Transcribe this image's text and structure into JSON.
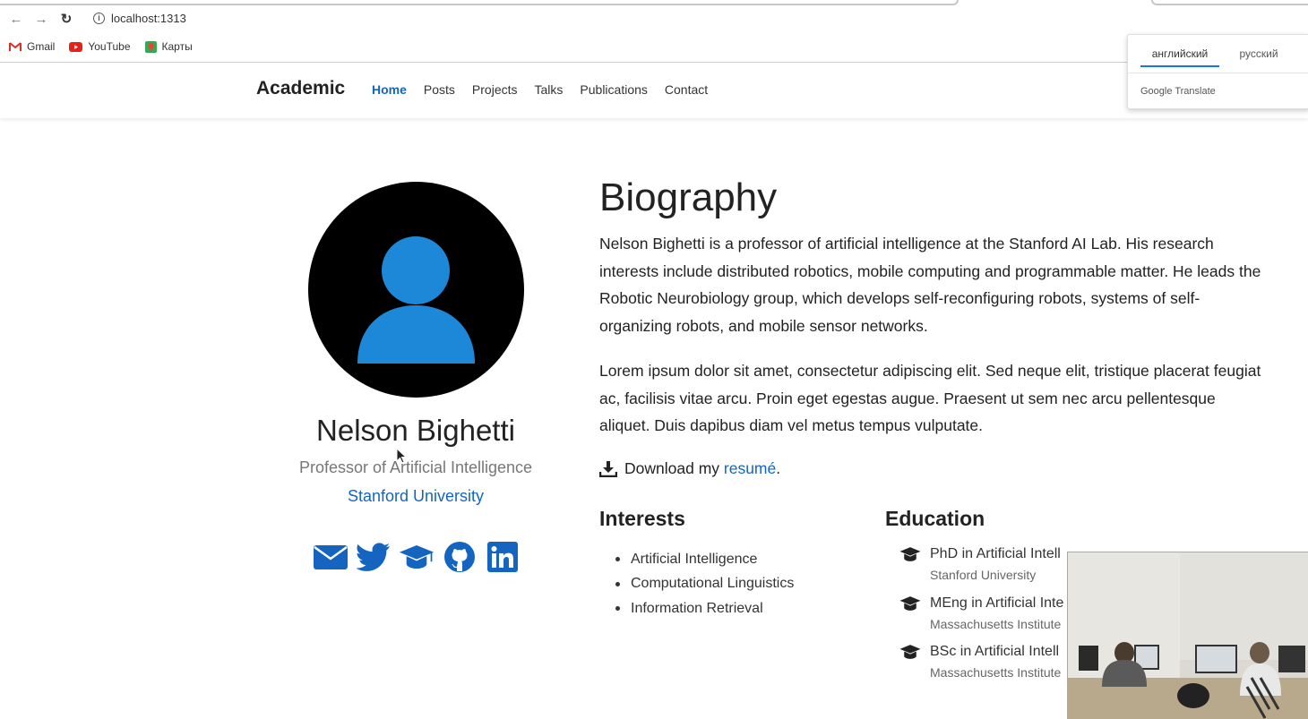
{
  "browser": {
    "url": "localhost:1313",
    "bookmarks": [
      {
        "label": "Gmail",
        "icon": "gmail-icon"
      },
      {
        "label": "YouTube",
        "icon": "youtube-icon"
      },
      {
        "label": "Карты",
        "icon": "maps-icon"
      }
    ]
  },
  "translate": {
    "tabs": [
      "английский",
      "русский"
    ],
    "active_tab": "английский",
    "brand": "Google Translate"
  },
  "nav": {
    "brand": "Academic",
    "items": [
      "Home",
      "Posts",
      "Projects",
      "Talks",
      "Publications",
      "Contact"
    ],
    "active": "Home"
  },
  "profile": {
    "name": "Nelson Bighetti",
    "role": "Professor of Artificial Intelligence",
    "organization": "Stanford University",
    "socials": [
      "envelope-icon",
      "twitter-icon",
      "graduation-cap-icon",
      "github-icon",
      "linkedin-icon"
    ]
  },
  "biography": {
    "title": "Biography",
    "paragraph1": "Nelson Bighetti is a professor of artificial intelligence at the Stanford AI Lab. His research interests include distributed robotics, mobile computing and programmable matter. He leads the Robotic Neurobiology group, which develops self-reconfiguring robots, systems of self-organizing robots, and mobile sensor networks.",
    "paragraph2": "Lorem ipsum dolor sit amet, consectetur adipiscing elit. Sed neque elit, tristique placerat feugiat ac, facilisis vitae arcu. Proin eget egestas augue. Praesent ut sem nec arcu pellentesque aliquet. Duis dapibus diam vel metus tempus vulputate.",
    "download_prefix": "Download my ",
    "download_link": "resumé",
    "download_suffix": "."
  },
  "interests": {
    "title": "Interests",
    "items": [
      "Artificial Intelligence",
      "Computational Linguistics",
      "Information Retrieval"
    ]
  },
  "education": {
    "title": "Education",
    "items": [
      {
        "degree": "PhD in Artificial Intell",
        "school": "Stanford University"
      },
      {
        "degree": "MEng in Artificial Inte",
        "school": "Massachusetts Institute"
      },
      {
        "degree": "BSc in Artificial Intell",
        "school": "Massachusetts Institute"
      }
    ]
  },
  "colors": {
    "accent": "#1565c0",
    "avatar_bg": "#000000",
    "avatar_figure": "#1e88d8"
  }
}
